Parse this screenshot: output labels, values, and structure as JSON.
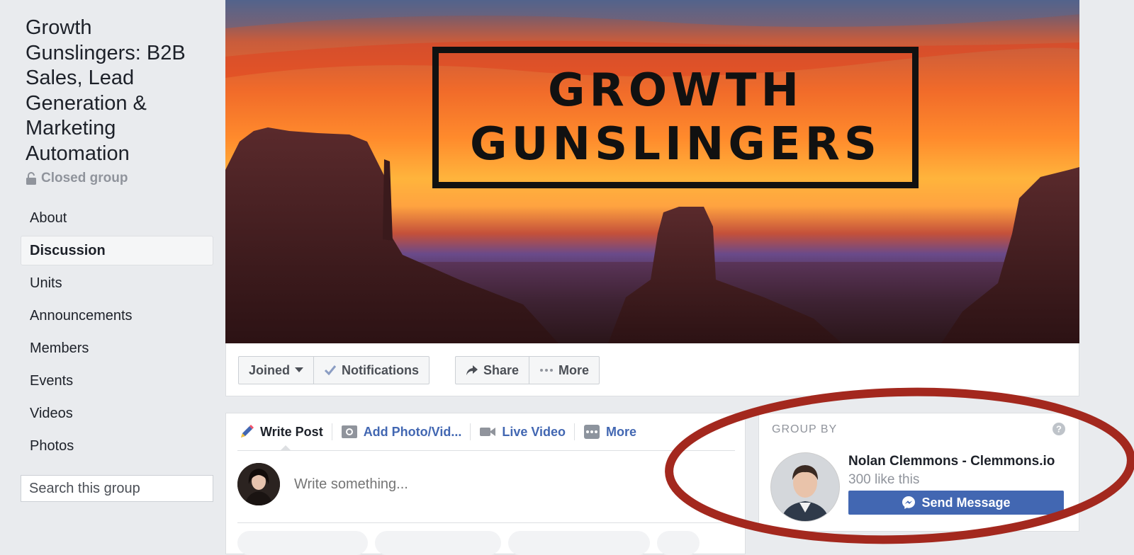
{
  "group": {
    "title": "Growth Gunslingers: B2B Sales, Lead Generation & Marketing Automation",
    "privacy": "Closed group"
  },
  "sidebar": {
    "items": [
      {
        "label": "About"
      },
      {
        "label": "Discussion",
        "active": true
      },
      {
        "label": "Units"
      },
      {
        "label": "Announcements"
      },
      {
        "label": "Members"
      },
      {
        "label": "Events"
      },
      {
        "label": "Videos"
      },
      {
        "label": "Photos"
      }
    ],
    "search_placeholder": "Search this group"
  },
  "cover": {
    "logo_line1": "GROWTH",
    "logo_line2": "GUNSLINGERS"
  },
  "actions": {
    "joined": "Joined",
    "notifications": "Notifications",
    "share": "Share",
    "more": "More"
  },
  "composer": {
    "tabs": [
      "Write Post",
      "Add Photo/Vid...",
      "Live Video",
      "More"
    ],
    "placeholder": "Write something..."
  },
  "group_by": {
    "title": "GROUP BY",
    "owner_name": "Nolan Clemmons - Clemmons.io",
    "likes": "300 like this",
    "send_message": "Send Message"
  },
  "colors": {
    "accent": "#4267b2",
    "annotation": "#a3281e",
    "background": "#e9ebee"
  }
}
